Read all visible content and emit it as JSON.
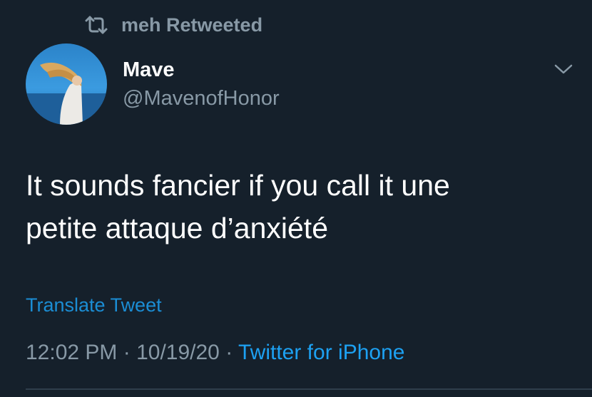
{
  "retweet": {
    "icon": "retweet-icon",
    "text": "meh Retweeted"
  },
  "author": {
    "name": "Mave",
    "handle": "@MavenofHonor",
    "avatar_icon": "avatar-photo"
  },
  "menu": {
    "icon": "chevron-down-icon"
  },
  "tweet": {
    "line1": "It sounds fancier if you call it une",
    "line2": "petite attaque d’anxiété"
  },
  "translate_label": "Translate Tweet",
  "meta": {
    "time": "12:02 PM",
    "sep1": " · ",
    "date": "10/19/20",
    "sep2": " · ",
    "source": "Twitter for iPhone"
  },
  "colors": {
    "background": "#15202b",
    "secondary_text": "#8899a6",
    "accent": "#1da1f2",
    "primary_text": "#ffffff"
  }
}
